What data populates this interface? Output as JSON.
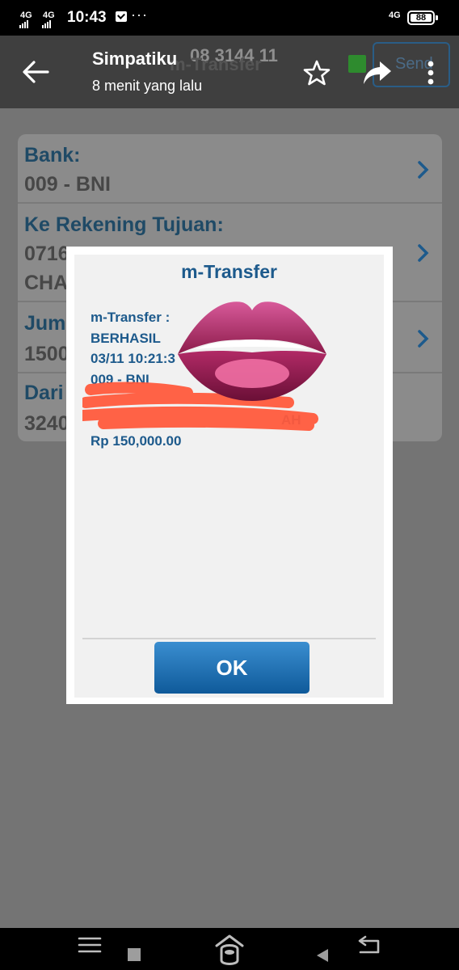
{
  "status_bar": {
    "signal_1": "4G",
    "signal_2": "4G",
    "time": "10:43",
    "overflow": "···",
    "network_right": "4G",
    "battery": "88"
  },
  "viewer": {
    "title": "Simpatiku",
    "subtitle": "8 menit yang lalu",
    "back_icon": "arrow-left-icon",
    "star_icon": "star-outline-icon",
    "share_icon": "share-arrow-icon",
    "more_icon": "more-vertical-icon"
  },
  "background_app": {
    "header_title": "m-Transfer",
    "header_number": "08 3144 11",
    "send_label": "Send",
    "rows": [
      {
        "label": "Bank:",
        "value": "009 - BNI"
      },
      {
        "label": "Ke Rekening Tujuan:",
        "value": "0716",
        "value2": "CHA"
      },
      {
        "label": "Juml",
        "value": "1500"
      },
      {
        "label": "Dari",
        "value": "3240"
      }
    ]
  },
  "dialog": {
    "title": "m-Transfer",
    "lines": [
      "m-Transfer :",
      "BERHASIL",
      "03/11 10:21:3",
      "009 - BNI",
      "Rp 150,000.00"
    ],
    "partial_line": "AH",
    "ok_label": "OK"
  },
  "nav_bar": {
    "icons": [
      "menu-icon",
      "square-icon",
      "home-icon",
      "back-triangle-icon",
      "return-icon"
    ]
  }
}
